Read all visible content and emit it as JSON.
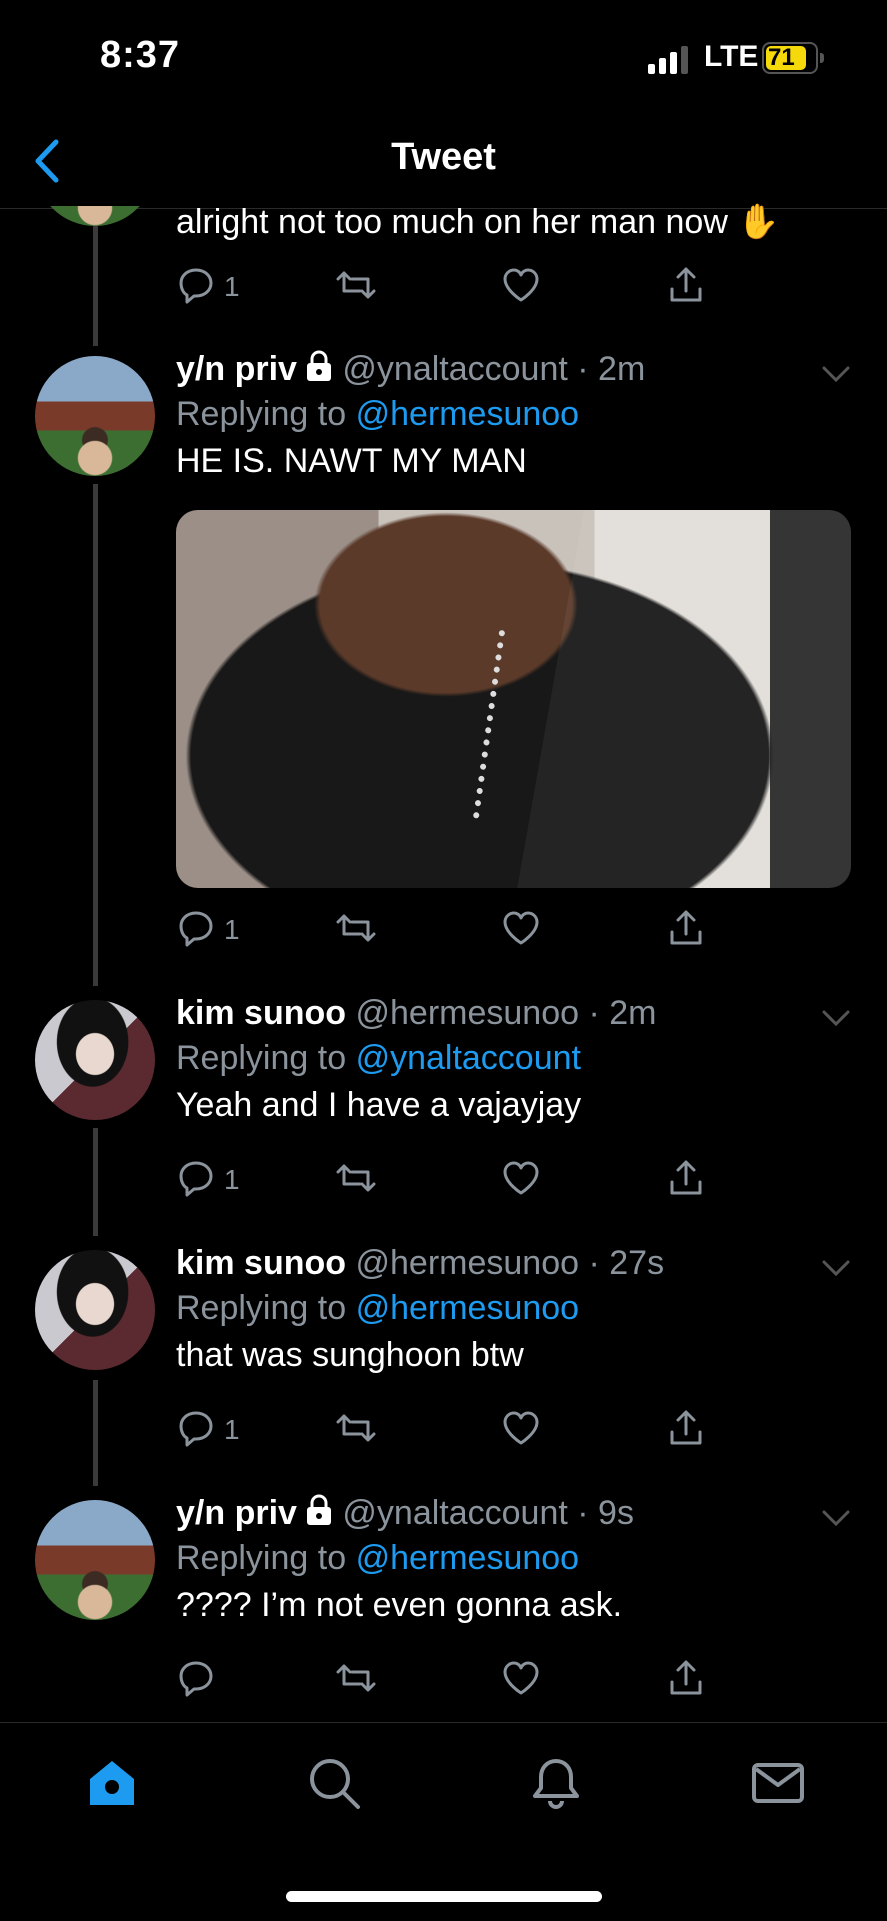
{
  "status_bar": {
    "time": "8:37",
    "network": "LTE",
    "battery": "71"
  },
  "header": {
    "title": "Tweet"
  },
  "top_tweet": {
    "text": "alright not too much on her man now ✋",
    "reply_count": "1"
  },
  "tweets": [
    {
      "name": "y/n priv",
      "locked": true,
      "handle": "@ynaltaccount",
      "time": "2m",
      "reply_label": "Replying to",
      "reply_to": "@hermesunoo",
      "text": "HE IS. NAWT MY MAN",
      "reply_count": "1"
    },
    {
      "name": "kim sunoo",
      "locked": false,
      "handle": "@hermesunoo",
      "time": "2m",
      "reply_label": "Replying to",
      "reply_to": "@ynaltaccount",
      "text": "Yeah and I have a vajayjay",
      "reply_count": "1"
    },
    {
      "name": "kim sunoo",
      "locked": false,
      "handle": "@hermesunoo",
      "time": "27s",
      "reply_label": "Replying to",
      "reply_to": "@hermesunoo",
      "text": "that was sunghoon btw",
      "reply_count": "1"
    },
    {
      "name": "y/n priv",
      "locked": true,
      "handle": "@ynaltaccount",
      "time": "9s",
      "reply_label": "Replying to",
      "reply_to": "@hermesunoo",
      "text": "???? I’m not even gonna ask.",
      "reply_count": ""
    }
  ],
  "dot": "·",
  "icons": [
    "back-icon",
    "reply-icon",
    "retweet-icon",
    "like-icon",
    "share-icon",
    "lock-icon",
    "chevron-down-icon",
    "home-icon",
    "search-icon",
    "notifications-icon",
    "messages-icon"
  ],
  "colors": {
    "accent": "#1d9bf0",
    "muted": "#8b949c",
    "battery": "#f5d90a"
  }
}
